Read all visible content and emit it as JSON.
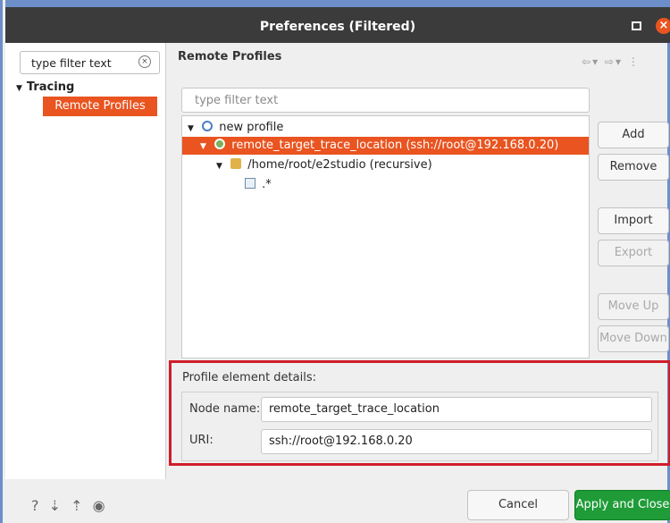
{
  "window": {
    "title": "Preferences (Filtered)"
  },
  "left_panel": {
    "filter_value": "type filter text",
    "tree": {
      "category": "Tracing",
      "selected_item": "Remote Profiles"
    }
  },
  "page": {
    "title": "Remote Profiles",
    "filter_placeholder": "type filter text",
    "tree": [
      {
        "label": "new profile",
        "level": 0
      },
      {
        "label": "remote_target_trace_location (ssh://root@192.168.0.20)",
        "level": 1,
        "selected": true
      },
      {
        "label": "/home/root/e2studio (recursive)",
        "level": 2
      },
      {
        "label": ".*",
        "level": 3
      }
    ],
    "buttons": {
      "add": "Add",
      "remove": "Remove",
      "import": "Import",
      "export": "Export",
      "move_up": "Move Up",
      "move_down": "Move Down"
    }
  },
  "details": {
    "header": "Profile element details:",
    "node_name_label": "Node name:",
    "node_name_value": "remote_target_trace_location",
    "uri_label": "URI:",
    "uri_value": "ssh://root@192.168.0.20"
  },
  "footer": {
    "cancel": "Cancel",
    "apply": "Apply and Close"
  },
  "colors": {
    "accent": "#e95420",
    "apply_button": "#1f9c38",
    "highlight_border": "#cf1d2a"
  }
}
